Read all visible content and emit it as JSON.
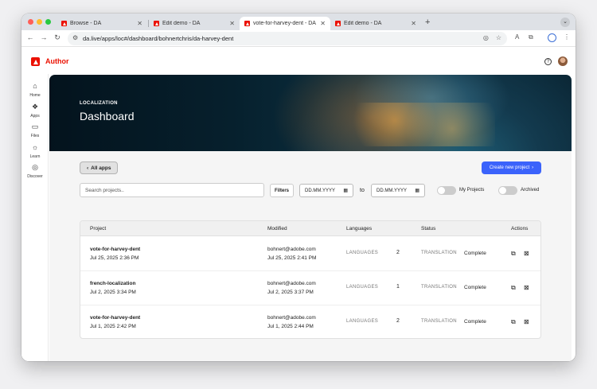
{
  "browser": {
    "tabs": [
      {
        "title": "Browse - DA",
        "active": false
      },
      {
        "title": "Edit demo - DA",
        "active": false
      },
      {
        "title": "vote-for-harvey-dent - DA Ti",
        "active": true
      },
      {
        "title": "Edit demo - DA",
        "active": false
      }
    ],
    "url": "da.live/apps/loc#/dashboard/bohnertchris/da-harvey-dent",
    "colors": {
      "close": "#ff5f57",
      "minimize": "#febc2e",
      "maximize": "#28c840"
    }
  },
  "app": {
    "brand": "Author",
    "accent": "#eb1000"
  },
  "rail": {
    "items": [
      {
        "label": "Home",
        "icon": "home-icon"
      },
      {
        "label": "Apps",
        "icon": "apps-icon"
      },
      {
        "label": "Files",
        "icon": "folder-icon"
      },
      {
        "label": "Learn",
        "icon": "lightbulb-icon"
      },
      {
        "label": "Discover",
        "icon": "compass-icon"
      }
    ]
  },
  "hero": {
    "eyebrow": "LOCALIZATION",
    "title": "Dashboard"
  },
  "toolbar": {
    "all_apps": "All apps",
    "create_project": "Create new project",
    "search_placeholder": "Search projects..",
    "filters": "Filters",
    "date_from_placeholder": "DD.MM.YYYY",
    "date_to_placeholder": "DD.MM.YYYY",
    "to_label": "to",
    "my_projects": "My Projects",
    "archived": "Archived",
    "primary_color": "#3b63fb"
  },
  "table": {
    "columns": [
      "Project",
      "Modified",
      "Languages",
      "Status",
      "Actions"
    ],
    "rows": [
      {
        "name": "vote-for-harvey-dent",
        "created": "Jul 25, 2025 2:36 PM",
        "email": "bohnert@adobe.com",
        "modified": "Jul 25, 2025 2:41 PM",
        "languages_label": "LANGUAGES",
        "languages": "2",
        "status_label": "TRANSLATION",
        "status": "Complete"
      },
      {
        "name": "french-localization",
        "created": "Jul 2, 2025 3:34 PM",
        "email": "bohnert@adobe.com",
        "modified": "Jul 2, 2025 3:37 PM",
        "languages_label": "LANGUAGES",
        "languages": "1",
        "status_label": "TRANSLATION",
        "status": "Complete"
      },
      {
        "name": "vote-for-harvey-dent",
        "created": "Jul 1, 2025 2:42 PM",
        "email": "bohnert@adobe.com",
        "modified": "Jul 1, 2025 2:44 PM",
        "languages_label": "LANGUAGES",
        "languages": "2",
        "status_label": "TRANSLATION",
        "status": "Complete"
      }
    ]
  }
}
